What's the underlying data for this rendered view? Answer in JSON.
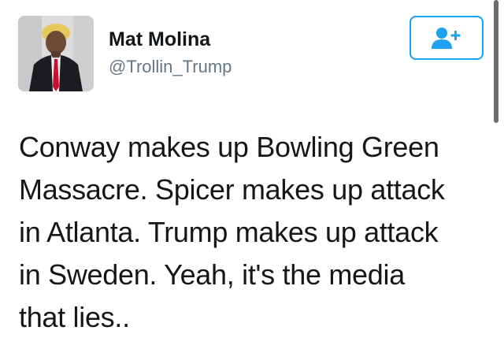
{
  "user": {
    "display_name": "Mat Molina",
    "handle": "@Trollin_Trump",
    "avatar_icon": "profile-photo"
  },
  "follow_button": {
    "icon": "add-user-icon",
    "accent_color": "#1da1f2"
  },
  "tweet": {
    "lines": [
      "Conway makes up Bowling Green",
      "Massacre. Spicer makes up attack",
      "in Atlanta. Trump makes up attack",
      "in Sweden. Yeah, it's the media",
      "that lies.."
    ]
  },
  "colors": {
    "text": "#14171a",
    "secondary": "#657786",
    "accent": "#1da1f2"
  }
}
